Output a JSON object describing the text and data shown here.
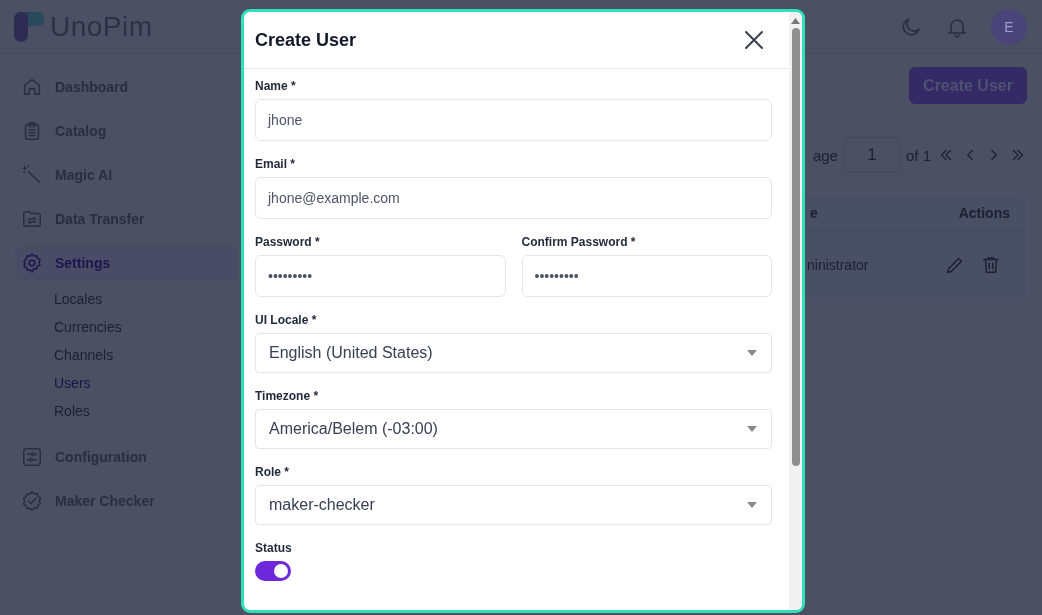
{
  "app": {
    "logo": "UnoPim"
  },
  "sidebar": {
    "items": [
      {
        "label": "Dashboard",
        "selected": false
      },
      {
        "label": "Catalog",
        "selected": false
      },
      {
        "label": "Magic AI",
        "selected": false
      },
      {
        "label": "Data Transfer",
        "selected": false
      },
      {
        "label": "Settings",
        "selected": true,
        "children": [
          {
            "label": "Locales",
            "selected": false
          },
          {
            "label": "Currencies",
            "selected": false
          },
          {
            "label": "Channels",
            "selected": false
          },
          {
            "label": "Users",
            "selected": true
          },
          {
            "label": "Roles",
            "selected": false
          }
        ]
      },
      {
        "label": "Configuration",
        "selected": false
      },
      {
        "label": "Maker Checker",
        "selected": false
      }
    ]
  },
  "header": {
    "avatar": "E"
  },
  "page": {
    "create_button": "Create User",
    "pagination": {
      "label": "age",
      "page": "1",
      "of": "of 1"
    },
    "table": {
      "columns": [
        "e",
        "Actions"
      ],
      "rows": [
        [
          "ninistrator"
        ]
      ]
    }
  },
  "dialog": {
    "title": "Create User",
    "rows": [
      [
        {
          "kind": "text",
          "label": "Name *",
          "value": "jhone"
        }
      ],
      [
        {
          "kind": "text",
          "label": "Email *",
          "value": "jhone@example.com"
        }
      ],
      [
        {
          "kind": "password",
          "label": "Password *",
          "value": "•••••••••"
        },
        {
          "kind": "password",
          "label": "Confirm Password *",
          "value": "•••••••••"
        }
      ],
      [
        {
          "kind": "select",
          "label": "UI Locale *",
          "value": "English (United States)"
        }
      ],
      [
        {
          "kind": "select",
          "label": "Timezone *",
          "value": "America/Belem (-03:00)"
        }
      ],
      [
        {
          "kind": "select",
          "label": "Role *",
          "value": "maker-checker"
        }
      ],
      [
        {
          "kind": "toggle",
          "label": "Status",
          "on": true
        }
      ]
    ]
  }
}
